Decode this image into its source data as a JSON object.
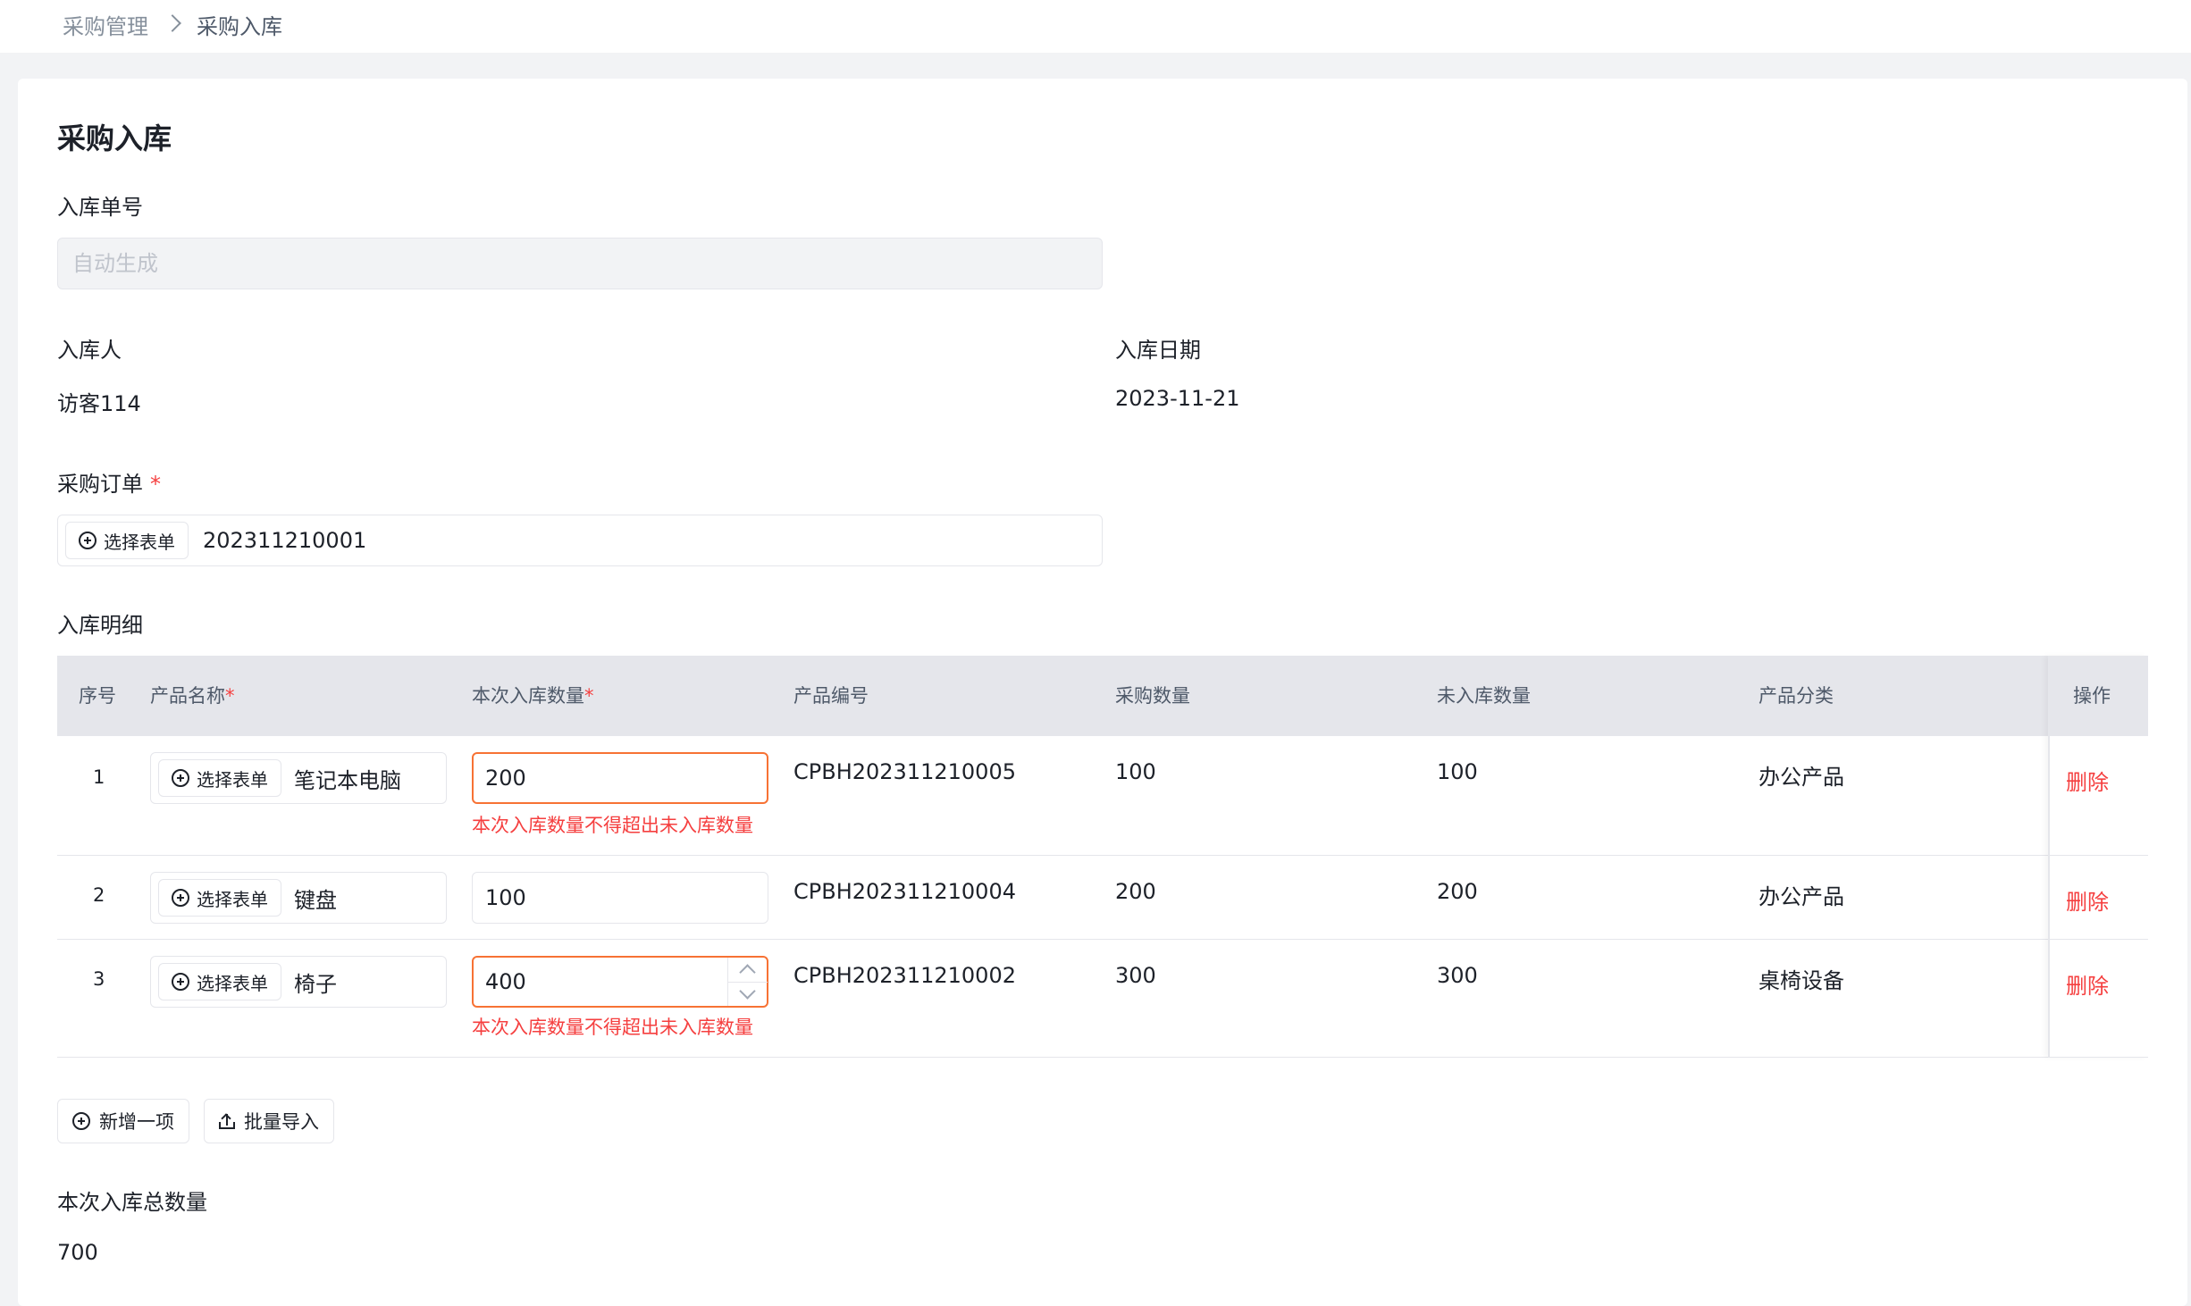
{
  "breadcrumb": {
    "parent": "采购管理",
    "current": "采购入库"
  },
  "page_title": "采购入库",
  "form": {
    "receipt_no_label": "入库单号",
    "receipt_no_placeholder": "自动生成",
    "operator_label": "入库人",
    "operator_value": "访客114",
    "date_label": "入库日期",
    "date_value": "2023-11-21",
    "order_label": "采购订单",
    "order_required_mark": "*",
    "order_select_label": "选择表单",
    "order_value": "202311210001",
    "details_label": "入库明细"
  },
  "table": {
    "headers": {
      "index": "序号",
      "product_name": "产品名称",
      "qty": "本次入库数量",
      "code": "产品编号",
      "purchase_qty": "采购数量",
      "pending_qty": "未入库数量",
      "category": "产品分类",
      "action": "操作",
      "required_mark": "*"
    },
    "select_label": "选择表单",
    "delete_label": "删除",
    "error_text": "本次入库数量不得超出未入库数量",
    "rows": [
      {
        "index": "1",
        "name": "笔记本电脑",
        "qty": "200",
        "code": "CPBH202311210005",
        "purchase_qty": "100",
        "pending_qty": "100",
        "category": "办公产品",
        "error": true
      },
      {
        "index": "2",
        "name": "键盘",
        "qty": "100",
        "code": "CPBH202311210004",
        "purchase_qty": "200",
        "pending_qty": "200",
        "category": "办公产品",
        "error": false
      },
      {
        "index": "3",
        "name": "椅子",
        "qty": "400",
        "code": "CPBH202311210002",
        "purchase_qty": "300",
        "pending_qty": "300",
        "category": "桌椅设备",
        "error": true
      }
    ]
  },
  "actions": {
    "add_item": "新增一项",
    "batch_import": "批量导入"
  },
  "summary": {
    "total_label": "本次入库总数量",
    "total_value": "700"
  },
  "colors": {
    "error": "#f53f3f",
    "error_border": "#f77234",
    "header_bg": "#e5e6eb",
    "page_bg": "#f2f3f5"
  },
  "icons": {
    "breadcrumb_separator": "chevron-right-icon",
    "select": "plus-circle-icon",
    "import": "upload-icon"
  }
}
